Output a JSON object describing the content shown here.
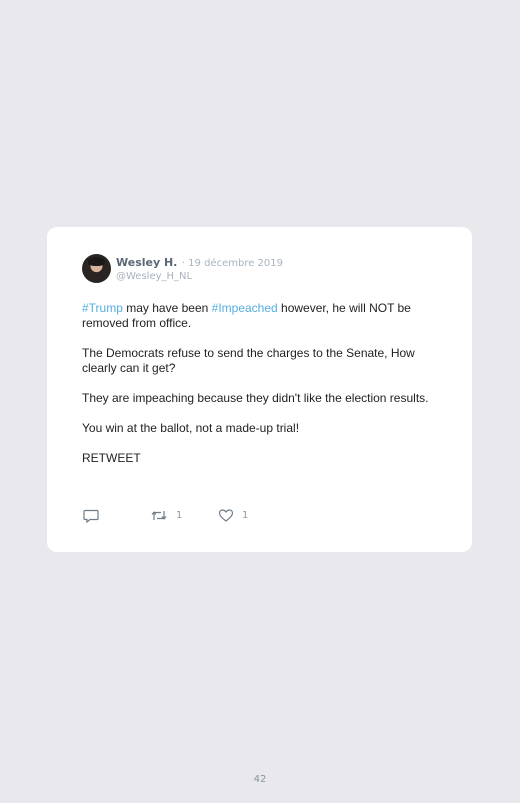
{
  "tweet": {
    "author_name": "Wesley H.",
    "date": "· 19 décembre 2019",
    "handle": "@Wesley_H_NL",
    "hashtag_1": "#Trump",
    "line1_after_hashtag_1": " may have been ",
    "hashtag_2": "#Impeached",
    "line1_after_hashtag_2": " however, he will NOT be removed from office.",
    "paragraph_2": "The Democrats refuse to send the charges to the Senate, How clearly can it get?",
    "paragraph_3": "They are impeaching because they didn't like the election results.",
    "paragraph_4": "You win at the ballot, not a made-up trial!",
    "paragraph_5": "RETWEET",
    "actions": {
      "reply_icon": "comment-icon",
      "retweet_icon": "retweet-icon",
      "retweet_count": "1",
      "like_icon": "heart-icon",
      "like_count": "1"
    }
  },
  "footer": {
    "page_number": "42"
  },
  "colors": {
    "background": "#e8e8ed",
    "card": "#ffffff",
    "hashtag": "#55aee0",
    "muted": "#a7b3bf"
  }
}
